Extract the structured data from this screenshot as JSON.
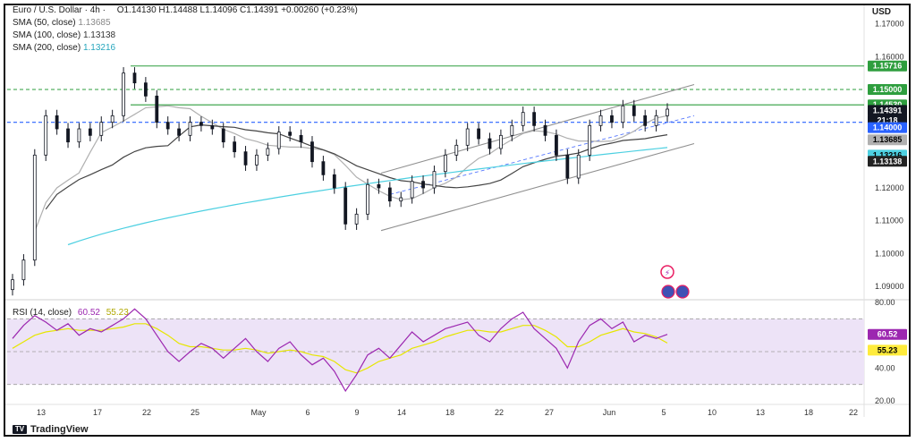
{
  "header": {
    "symbol": "Euro / U.S. Dollar · 4h ·",
    "ohlc": "O1.14130 H1.14488 L1.14096 C1.14391 +0.00260 (+0.23%)",
    "sma50_label": "SMA (50, close)",
    "sma50_value": "1.13685",
    "sma100_label": "SMA (100, close)",
    "sma100_value": "1.13138",
    "sma200_label": "SMA (200, close)",
    "sma200_value": "1.13216",
    "currency": "USD"
  },
  "rsi_header": {
    "label": "RSI (14, close)",
    "rsi_value": "60.52",
    "ma_value": "55.23"
  },
  "branding": {
    "name": "TradingView"
  },
  "colors": {
    "candle": "#131722",
    "sma50": "#b0b0b0",
    "sma100": "#444444",
    "sma200": "#4dd0e1",
    "green_level": "#2e9e3e",
    "blue_level": "#2962ff",
    "rsi_line": "#9c27b0",
    "rsi_ma": "#e6e600",
    "rsi_band": "#ede3f7"
  },
  "chart_data": {
    "type": "candlestick",
    "ylim": [
      1.087,
      1.174
    ],
    "x_ticks": [
      "13",
      "17",
      "22",
      "25",
      "May",
      "6",
      "9",
      "14",
      "18",
      "22",
      "27",
      "Jun",
      "5",
      "10",
      "13",
      "18",
      "22"
    ],
    "y_ticks": [
      "1.17000",
      "1.16000",
      "1.15000",
      "1.14000",
      "1.13000",
      "1.12000",
      "1.11000",
      "1.10000",
      "1.09000"
    ],
    "price_labels": [
      {
        "value": "1.15716",
        "kind": "green"
      },
      {
        "value": "1.15000",
        "kind": "green"
      },
      {
        "value": "1.14530",
        "kind": "green"
      },
      {
        "value": "1.14391",
        "kind": "current"
      },
      {
        "value": "21:18",
        "kind": "countdown"
      },
      {
        "value": "1.14000",
        "kind": "blue"
      },
      {
        "value": "1.13685",
        "kind": "sma50"
      },
      {
        "value": "1.13216",
        "kind": "sma200"
      },
      {
        "value": "1.13138",
        "kind": "sma100"
      }
    ],
    "levels": [
      {
        "value": 1.15716,
        "style": "solid"
      },
      {
        "value": 1.15,
        "style": "dashed"
      },
      {
        "value": 1.1453,
        "style": "solid"
      },
      {
        "value": 1.14,
        "style": "dashed"
      }
    ],
    "channel": {
      "upper": [
        [
          1.1245,
          1.1515
        ]
      ],
      "lower": [
        [
          1.107,
          1.1335
        ]
      ]
    },
    "close_path": [
      1.092,
      1.098,
      1.13,
      1.142,
      1.138,
      1.134,
      1.138,
      1.136,
      1.14,
      1.142,
      1.155,
      1.152,
      1.148,
      1.14,
      1.138,
      1.136,
      1.14,
      1.139,
      1.138,
      1.134,
      1.131,
      1.127,
      1.13,
      1.132,
      1.137,
      1.136,
      1.134,
      1.128,
      1.124,
      1.12,
      1.109,
      1.112,
      1.121,
      1.12,
      1.116,
      1.117,
      1.122,
      1.12,
      1.125,
      1.13,
      1.133,
      1.138,
      1.135,
      1.132,
      1.136,
      1.139,
      1.143,
      1.139,
      1.136,
      1.13,
      1.123,
      1.13,
      1.139,
      1.142,
      1.14,
      1.145,
      1.142,
      1.139,
      1.142,
      1.144
    ],
    "rsi": {
      "ylim": [
        20,
        80
      ],
      "y_ticks": [
        "80.00",
        "60.00",
        "40.00",
        "20.00"
      ],
      "band": [
        30,
        70
      ],
      "values": [
        58,
        66,
        72,
        68,
        63,
        67,
        60,
        64,
        62,
        66,
        70,
        76,
        70,
        60,
        50,
        44,
        50,
        55,
        52,
        46,
        52,
        58,
        50,
        44,
        52,
        56,
        48,
        42,
        46,
        38,
        26,
        36,
        48,
        52,
        46,
        54,
        62,
        56,
        60,
        64,
        66,
        68,
        60,
        56,
        64,
        70,
        74,
        64,
        58,
        52,
        40,
        56,
        66,
        70,
        64,
        68,
        56,
        60,
        58,
        60.52
      ],
      "ma_values": [
        52,
        56,
        60,
        62,
        63,
        64,
        63,
        63,
        63,
        64,
        65,
        67,
        67,
        64,
        60,
        55,
        53,
        53,
        52,
        51,
        51,
        52,
        51,
        49,
        50,
        51,
        50,
        48,
        47,
        44,
        39,
        37,
        40,
        44,
        46,
        48,
        52,
        54,
        56,
        59,
        61,
        63,
        63,
        62,
        62,
        64,
        66,
        66,
        63,
        59,
        53,
        53,
        56,
        60,
        62,
        64,
        62,
        61,
        59,
        55.23
      ]
    }
  }
}
